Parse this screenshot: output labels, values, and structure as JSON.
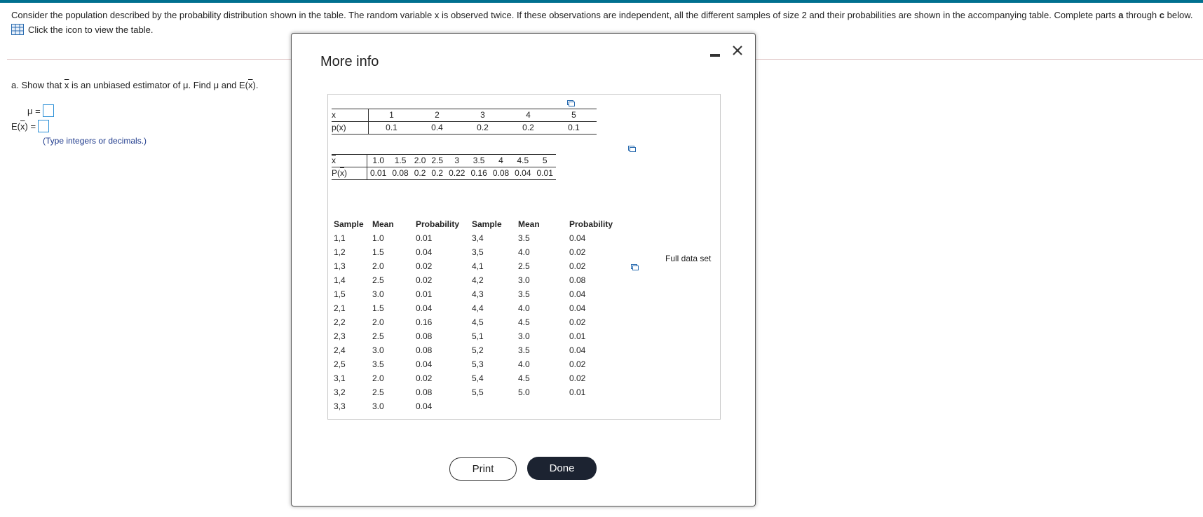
{
  "question": {
    "prompt_pre": "Consider the population described by the probability distribution shown in the table. The random variable x is observed twice. If these observations are independent, all the different samples of size 2 and their probabilities are shown in the accompanying table. Complete parts ",
    "prompt_a": "a",
    "prompt_through": " through ",
    "prompt_c": "c",
    "prompt_post": " below.",
    "table_link": "Click the icon to view the table."
  },
  "part_a": {
    "text_pre": "a. Show that ",
    "xbar": "x",
    "text_mid": " is an unbiased estimator of μ. Find μ and E",
    "ex": "x",
    "text_post": ".",
    "mu_label": "μ =",
    "mu_value": "",
    "ex_label_pre": "E",
    "ex_label_x": "x",
    "ex_label_post": " =",
    "ex_value": "",
    "hint": "(Type integers or decimals.)"
  },
  "modal": {
    "title": "More info",
    "print_label": "Print",
    "done_label": "Done",
    "full_data_label": "Full data set",
    "dist": {
      "row1_label": "x",
      "row2_label": "p(x)",
      "x": [
        "1",
        "2",
        "3",
        "4",
        "5"
      ],
      "p": [
        "0.1",
        "0.4",
        "0.2",
        "0.2",
        "0.1"
      ]
    },
    "sampling": {
      "row1_label": "x",
      "row2_label": "P(x)",
      "xbar": [
        "1.0",
        "1.5",
        "2.0",
        "2.5",
        "3",
        "3.5",
        "4",
        "4.5",
        "5"
      ],
      "p": [
        "0.01",
        "0.08",
        "0.2",
        "0.2",
        "0.22",
        "0.16",
        "0.08",
        "0.04",
        "0.01"
      ]
    },
    "samples": {
      "headers": [
        "Sample",
        "Mean",
        "Probability",
        "Sample",
        "Mean",
        "Probability"
      ],
      "left": [
        [
          "1,1",
          "1.0",
          "0.01"
        ],
        [
          "1,2",
          "1.5",
          "0.04"
        ],
        [
          "1,3",
          "2.0",
          "0.02"
        ],
        [
          "1,4",
          "2.5",
          "0.02"
        ],
        [
          "1,5",
          "3.0",
          "0.01"
        ],
        [
          "2,1",
          "1.5",
          "0.04"
        ],
        [
          "2,2",
          "2.0",
          "0.16"
        ],
        [
          "2,3",
          "2.5",
          "0.08"
        ],
        [
          "2,4",
          "3.0",
          "0.08"
        ],
        [
          "2,5",
          "3.5",
          "0.04"
        ],
        [
          "3,1",
          "2.0",
          "0.02"
        ],
        [
          "3,2",
          "2.5",
          "0.08"
        ],
        [
          "3,3",
          "3.0",
          "0.04"
        ]
      ],
      "right": [
        [
          "3,4",
          "3.5",
          "0.04"
        ],
        [
          "3,5",
          "4.0",
          "0.02"
        ],
        [
          "4,1",
          "2.5",
          "0.02"
        ],
        [
          "4,2",
          "3.0",
          "0.08"
        ],
        [
          "4,3",
          "3.5",
          "0.04"
        ],
        [
          "4,4",
          "4.0",
          "0.04"
        ],
        [
          "4,5",
          "4.5",
          "0.02"
        ],
        [
          "5,1",
          "3.0",
          "0.01"
        ],
        [
          "5,2",
          "3.5",
          "0.04"
        ],
        [
          "5,3",
          "4.0",
          "0.02"
        ],
        [
          "5,4",
          "4.5",
          "0.02"
        ],
        [
          "5,5",
          "5.0",
          "0.01"
        ]
      ]
    }
  },
  "colors": {
    "accent": "#00708f",
    "link": "#1e3a8c",
    "input_border": "#2b8fd6",
    "done_bg": "#1c2331"
  }
}
